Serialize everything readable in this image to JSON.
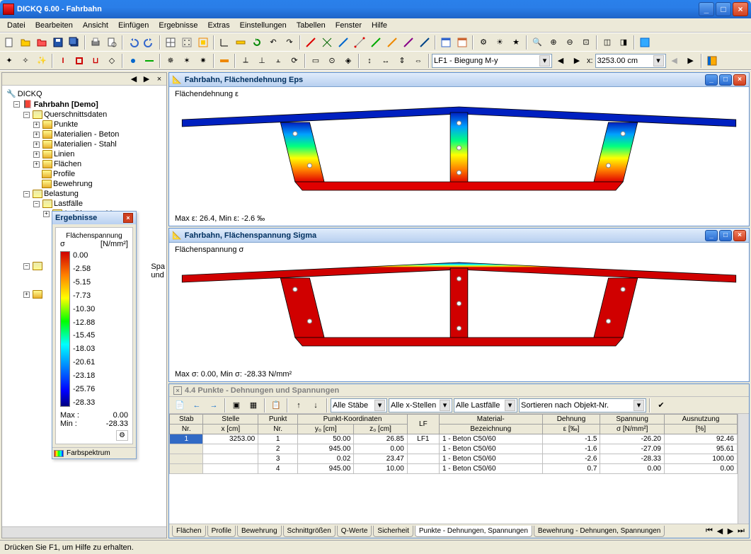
{
  "app": {
    "title": "DICKQ 6.00 - Fahrbahn"
  },
  "menu": [
    "Datei",
    "Bearbeiten",
    "Ansicht",
    "Einfügen",
    "Ergebnisse",
    "Extras",
    "Einstellungen",
    "Tabellen",
    "Fenster",
    "Hilfe"
  ],
  "toolbar2": {
    "combo_lf": "LF1 - Biegung M-y",
    "x_label": "x:",
    "x_value": "3253.00 cm"
  },
  "tree": {
    "root": "DICKQ",
    "project": "Fahrbahn [Demo]",
    "nodes": [
      "Querschnittsdaten",
      "Punkte",
      "Materialien - Beton",
      "Materialien - Stahl",
      "Linien",
      "Flächen",
      "Profile",
      "Bewehrung",
      "Belastung",
      "Lastfälle",
      "1 - Biegung M-y"
    ],
    "peek": [
      "Spa",
      "und"
    ]
  },
  "ergebnisse": {
    "title": "Ergebnisse",
    "header1": "Flächenspannung",
    "subheader_sigma": "σ",
    "header2_units": "[N/mm²]",
    "ticks": [
      "0.00",
      "-2.58",
      "-5.15",
      "-7.73",
      "-10.30",
      "-12.88",
      "-15.45",
      "-18.03",
      "-20.61",
      "-23.18",
      "-25.76",
      "-28.33"
    ],
    "max_label": "Max :",
    "max_val": "0.00",
    "min_label": "Min :",
    "min_val": "-28.33",
    "footer_btn": "Farbspektrum"
  },
  "plot1": {
    "title": "Fahrbahn, Flächendehnung Eps",
    "label": "Flächendehnung ε",
    "footer": "Max ε: 26.4, Min ε: -2.6 ‰"
  },
  "plot2": {
    "title": "Fahrbahn, Flächenspannung Sigma",
    "label": "Flächenspannung σ",
    "footer": "Max σ: 0.00, Min σ: -28.33 N/mm²"
  },
  "table_panel": {
    "title": "4.4 Punkte - Dehnungen und Spannungen",
    "combo1": "Alle Stäbe",
    "combo2": "Alle x-Stellen",
    "combo3": "Alle Lastfälle",
    "combo4": "Sortieren nach Objekt-Nr."
  },
  "table": {
    "headers_row1": [
      "Stab",
      "Stelle",
      "Punkt",
      "Punkt-Koordinaten",
      "",
      "LF",
      "Material-",
      "Dehnung",
      "Spannung",
      "Ausnutzung"
    ],
    "headers_row2": [
      "Nr.",
      "x [cm]",
      "Nr.",
      "y₀ [cm]",
      "z₀ [cm]",
      "",
      "Bezeichnung",
      "ε [‰]",
      "σ [N/mm²]",
      "[%]"
    ],
    "rows": [
      {
        "stab": "1",
        "x": "3253.00",
        "punkt": "1",
        "y0": "50.00",
        "z0": "26.85",
        "lf": "LF1",
        "mat": "1 - Beton C50/60",
        "eps": "-1.5",
        "sigma": "-26.20",
        "aus": "92.46"
      },
      {
        "stab": "",
        "x": "",
        "punkt": "2",
        "y0": "945.00",
        "z0": "0.00",
        "lf": "",
        "mat": "1 - Beton C50/60",
        "eps": "-1.6",
        "sigma": "-27.09",
        "aus": "95.61"
      },
      {
        "stab": "",
        "x": "",
        "punkt": "3",
        "y0": "0.02",
        "z0": "23.47",
        "lf": "",
        "mat": "1 - Beton C50/60",
        "eps": "-2.6",
        "sigma": "-28.33",
        "aus": "100.00"
      },
      {
        "stab": "",
        "x": "",
        "punkt": "4",
        "y0": "945.00",
        "z0": "10.00",
        "lf": "",
        "mat": "1 - Beton C50/60",
        "eps": "0.7",
        "sigma": "0.00",
        "aus": "0.00"
      }
    ]
  },
  "tabs": [
    "Flächen",
    "Profile",
    "Bewehrung",
    "Schnittgrößen",
    "Q-Werte",
    "Sicherheit",
    "Punkte - Dehnungen, Spannungen",
    "Bewehrung - Dehnungen, Spannungen"
  ],
  "active_tab": "Punkte - Dehnungen, Spannungen",
  "status": "Drücken Sie F1, um Hilfe zu erhalten.",
  "chart_data": {
    "plot1_type": "contour",
    "plot1_variable": "Flächendehnung ε [‰]",
    "plot1_range": [
      -2.6,
      26.4
    ],
    "plot2_type": "contour",
    "plot2_variable": "Flächenspannung σ [N/mm²]",
    "plot2_range": [
      -28.33,
      0.0
    ],
    "legend_ticks": [
      0.0,
      -2.58,
      -5.15,
      -7.73,
      -10.3,
      -12.88,
      -15.45,
      -18.03,
      -20.61,
      -23.18,
      -25.76,
      -28.33
    ]
  }
}
